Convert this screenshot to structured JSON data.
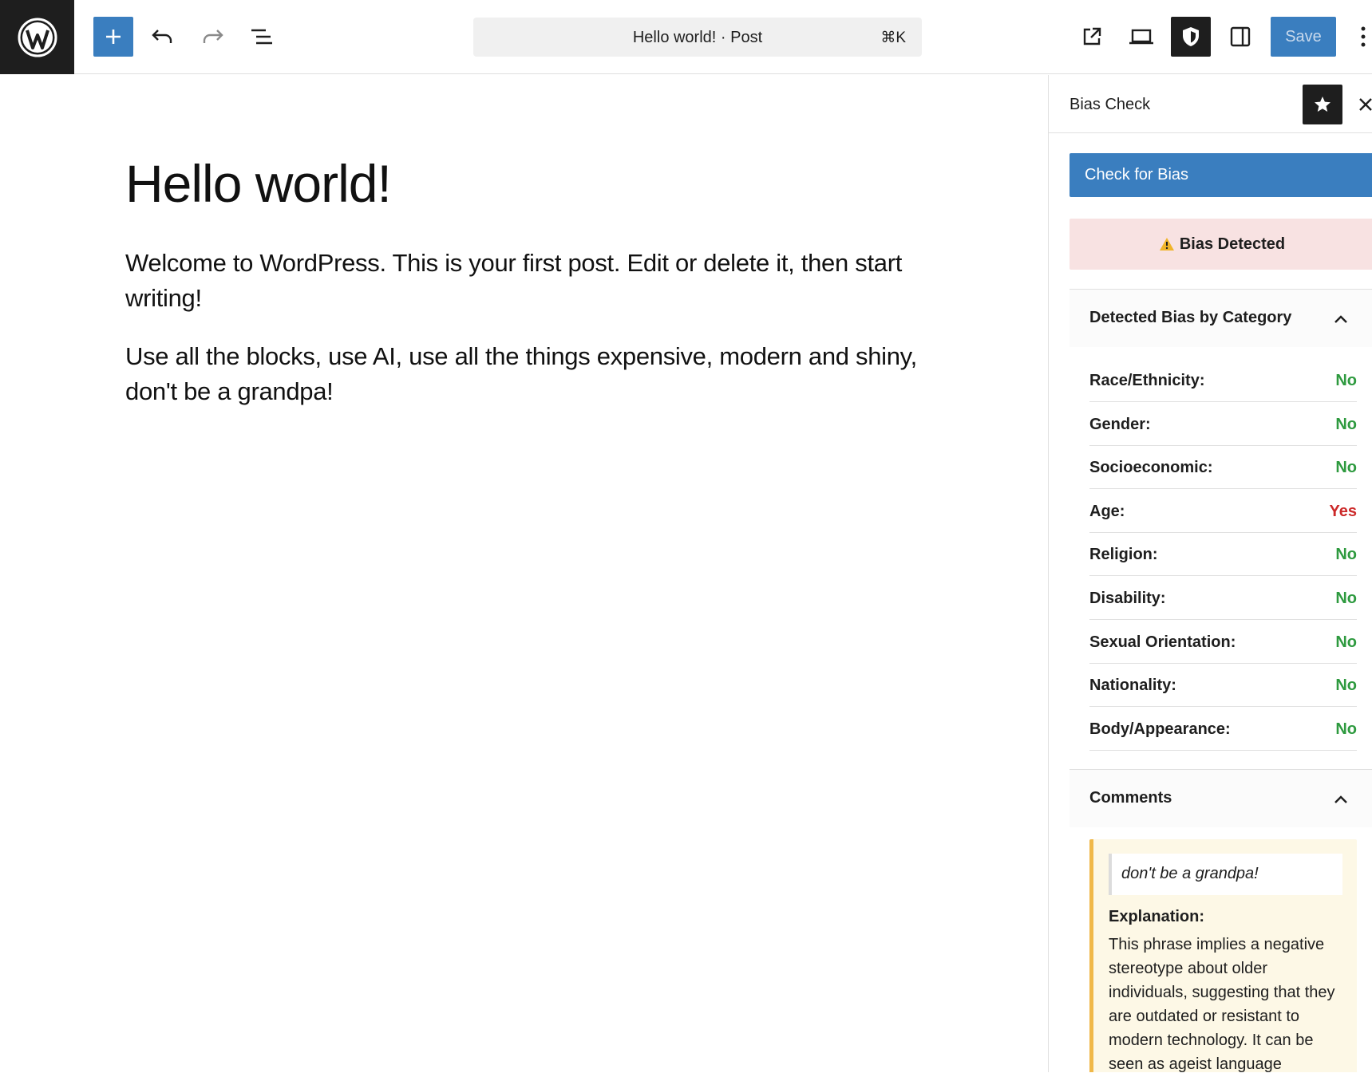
{
  "toolbar": {
    "wp_logo_icon": "wordpress-logo",
    "add_block_icon": "plus-icon",
    "undo_icon": "undo-icon",
    "redo_icon": "redo-icon",
    "list_view_icon": "list-view-icon",
    "command_bar": {
      "title": "Hello world! · Post",
      "shortcut": "⌘K"
    },
    "view_post_icon": "external-link-icon",
    "preview_icon": "desktop-preview-icon",
    "plugin_icon": "shield-icon",
    "settings_icon": "sidebar-toggle-icon",
    "save_label": "Save",
    "more_icon": "vertical-ellipsis-icon"
  },
  "editor": {
    "title": "Hello world!",
    "paragraphs": [
      "Welcome to WordPress. This is your first post. Edit or delete it, then start writing!",
      "Use all the blocks, use AI, use all the things expensive, modern and shiny, don't be a grandpa!"
    ]
  },
  "sidebar": {
    "title": "Bias Check",
    "check_button": "Check for Bias",
    "alert": "Bias Detected",
    "categories_panel": {
      "title": "Detected Bias by Category",
      "rows": [
        {
          "label": "Race/Ethnicity:",
          "value": "No"
        },
        {
          "label": "Gender:",
          "value": "No"
        },
        {
          "label": "Socioeconomic:",
          "value": "No"
        },
        {
          "label": "Age:",
          "value": "Yes"
        },
        {
          "label": "Religion:",
          "value": "No"
        },
        {
          "label": "Disability:",
          "value": "No"
        },
        {
          "label": "Sexual Orientation:",
          "value": "No"
        },
        {
          "label": "Nationality:",
          "value": "No"
        },
        {
          "label": "Body/Appearance:",
          "value": "No"
        }
      ]
    },
    "comments_panel": {
      "title": "Comments",
      "items": [
        {
          "quote": "don't be a grandpa!",
          "explanation_label": "Explanation:",
          "explanation": "This phrase implies a negative stereotype about older individuals, suggesting that they are outdated or resistant to modern technology. It can be seen as ageist language"
        }
      ]
    }
  },
  "colors": {
    "accent": "#3a7ebf",
    "dark": "#1e1e1e",
    "no": "#2e9a3f",
    "yes": "#cc2929",
    "alert_bg": "#f8e2e2",
    "comment_border": "#f0b849"
  }
}
